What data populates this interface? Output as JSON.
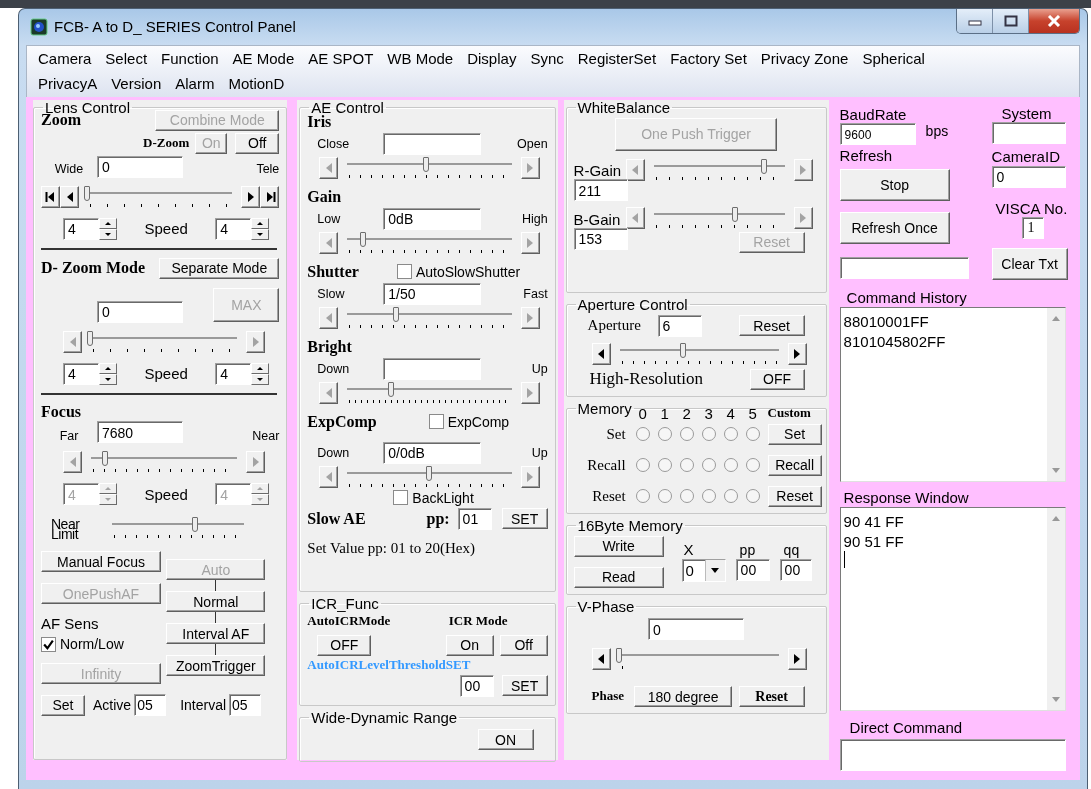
{
  "window": {
    "title": "FCB- A to D_ SERIES Control Panel"
  },
  "menu_rows": [
    [
      "Camera",
      "Select",
      "Function",
      "AE Mode",
      "AE SPOT",
      "WB Mode",
      "Display",
      "Sync",
      "RegisterSet",
      "Factory Set",
      "Privacy Zone",
      "Spherical"
    ],
    [
      "PrivacyA",
      "Version",
      "Alarm",
      "MotionD"
    ]
  ],
  "lens_control": {
    "title": "Lens Control",
    "combine_button": {
      "label": "Combine Mode",
      "disabled": true
    },
    "zoom": {
      "heading": "Zoom",
      "dzoom_label": "D-Zoom",
      "on_button": {
        "label": "On",
        "disabled": true
      },
      "off_button": {
        "label": "Off"
      },
      "wide_label": "Wide",
      "value": "0",
      "tele_label": "Tele",
      "slider": {
        "level": 0
      },
      "speed_label": "Speed",
      "speed_left": {
        "value": "4"
      },
      "speed_right": {
        "value": "4"
      }
    },
    "dzoom_mode": {
      "heading": "D- Zoom Mode",
      "mode_button": {
        "label": "Separate Mode"
      },
      "value": "0",
      "max_button": {
        "label": "MAX",
        "disabled": true
      },
      "slider": {
        "level": 0,
        "disabled": true
      },
      "speed_label": "Speed",
      "speed_left": {
        "value": "4"
      },
      "speed_right": {
        "value": "4"
      }
    },
    "focus": {
      "heading": "Focus",
      "far_label": "Far",
      "value": "7680",
      "near_label": "Near",
      "slider": {
        "level": 0.1,
        "disabled": true
      },
      "speed_label": "Speed",
      "speed_left": {
        "value": "4",
        "disabled": true
      },
      "speed_right": {
        "value": "4",
        "disabled": true
      },
      "near_limit_label": "Near Limit",
      "near_limit_slider": {
        "level": 0.63
      }
    },
    "manual_focus_button": {
      "label": "Manual Focus"
    },
    "onepush_button": {
      "label": "OnePushAF",
      "disabled": true
    },
    "af_sens_label": "AF Sens",
    "norm_low": {
      "label": "Norm/Low",
      "checked": true
    },
    "infinity_button": {
      "label": "Infinity",
      "disabled": true
    },
    "af_mode_buttons": [
      {
        "label": "Auto",
        "disabled": true
      },
      {
        "label": "Normal"
      },
      {
        "label": "Interval AF"
      },
      {
        "label": "ZoomTrigger"
      }
    ],
    "set_button": {
      "label": "Set"
    },
    "active_label": "Active",
    "active_value": "05",
    "interval_label": "Interval",
    "interval_value": "05"
  },
  "ae_control": {
    "title": "AE Control",
    "sliders": [
      {
        "heading": "Iris",
        "low_label": "Close",
        "high_label": "Open",
        "level": 0.48,
        "disabled": true
      },
      {
        "heading": "Gain",
        "low_label": "Low",
        "value": "0dB",
        "high_label": "High",
        "level": 0.1,
        "disabled": true
      },
      {
        "heading": "Shutter",
        "checkbox": {
          "label": "AutoSlowShutter",
          "checked": false
        },
        "low_label": "Slow",
        "value": "1/50",
        "high_label": "Fast",
        "level": 0.3,
        "disabled": true
      },
      {
        "heading": "Bright",
        "low_label": "Down",
        "high_label": "Up",
        "level": 0.27,
        "disabled": true
      },
      {
        "heading": "ExpComp",
        "checkbox": {
          "label": "ExpComp",
          "checked": false
        },
        "low_label": "Down",
        "value": "0/0dB",
        "high_label": "Up",
        "level": 0.5,
        "disabled": true
      }
    ],
    "backlight": {
      "label": "BackLight",
      "checked": false
    },
    "slow_ae": {
      "heading": "Slow AE",
      "pp_label": "pp:",
      "value": "01",
      "button": {
        "label": "SET"
      }
    },
    "note": "Set Value pp: 01 to 20(Hex)"
  },
  "icr_func": {
    "title": "ICR_Func",
    "auto_label": "AutoICRMode",
    "auto_button": {
      "label": "OFF"
    },
    "mode_label": "ICR Mode",
    "on_button": {
      "label": "On"
    },
    "off_button": {
      "label": "Off"
    },
    "threshold_label": "AutoICRLevelThresholdSET",
    "threshold_value": "00",
    "set_button": {
      "label": "SET"
    }
  },
  "wide_dynamic_range": {
    "title": "Wide-Dynamic Range",
    "button": {
      "label": "ON"
    }
  },
  "white_balance": {
    "title": "WhiteBalance",
    "trigger_button": {
      "label": "One Push Trigger",
      "disabled": true
    },
    "gains": [
      {
        "label": "R-Gain",
        "value": "211",
        "level": 0.84,
        "disabled": true
      },
      {
        "label": "B-Gain",
        "value": "153",
        "level": 0.62,
        "disabled": true
      }
    ],
    "reset_button": {
      "label": "Reset",
      "disabled": true
    }
  },
  "aperture_control": {
    "title": "Aperture Control",
    "label": "Aperture",
    "value": "6",
    "reset_button": {
      "label": "Reset"
    },
    "slider": {
      "level": 0.4
    },
    "high_res_label": "High-Resolution",
    "high_res_button": {
      "label": "OFF"
    }
  },
  "memory": {
    "title": "Memory",
    "numbers": [
      "0",
      "1",
      "2",
      "3",
      "4",
      "5"
    ],
    "custom_label": "Custom",
    "rows": [
      {
        "label": "Set",
        "radios": [
          {
            "selected": false
          },
          {
            "selected": false
          },
          {
            "selected": false
          },
          {
            "selected": false
          },
          {
            "selected": false
          },
          {
            "selected": false
          }
        ],
        "button": {
          "label": "Set"
        }
      },
      {
        "label": "Recall",
        "radios": [
          {
            "selected": false
          },
          {
            "selected": false
          },
          {
            "selected": false
          },
          {
            "selected": false
          },
          {
            "selected": false
          },
          {
            "selected": false
          }
        ],
        "button": {
          "label": "Recall"
        }
      },
      {
        "label": "Reset",
        "radios": [
          {
            "selected": false
          },
          {
            "selected": false
          },
          {
            "selected": false
          },
          {
            "selected": false
          },
          {
            "selected": false
          },
          {
            "selected": false
          }
        ],
        "button": {
          "label": "Reset"
        }
      }
    ]
  },
  "byte16_memory": {
    "title": "16Byte Memory",
    "write_button": {
      "label": "Write"
    },
    "read_button": {
      "label": "Read"
    },
    "x_label": "X",
    "x_value": "0",
    "pp_label": "pp",
    "pp_value": "00",
    "qq_label": "qq",
    "qq_value": "00"
  },
  "v_phase": {
    "title": "V-Phase",
    "value": "0",
    "slider": {
      "level": 0
    },
    "phase_label": "Phase",
    "degree_button": {
      "label": "180 degree"
    },
    "reset_button": {
      "label": "Reset"
    }
  },
  "connection": {
    "baud_label": "BaudRate",
    "baud_value": "9600",
    "bps_label": "bps",
    "system_label": "System",
    "refresh_label": "Refresh",
    "stop_button": {
      "label": "Stop"
    },
    "camera_id_label": "CameraID",
    "camera_id_value": "0",
    "refresh_once_button": {
      "label": "Refresh Once"
    },
    "visca_label": "VISCA No.",
    "visca_value": "1",
    "clear_button": {
      "label": "Clear Txt"
    },
    "history_label": "Command History",
    "history_lines": [
      "88010001FF",
      "8101045802FF"
    ],
    "response_label": "Response Window",
    "response_lines": [
      "90 41 FF",
      "90 51 FF"
    ],
    "direct_label": "Direct Command"
  }
}
